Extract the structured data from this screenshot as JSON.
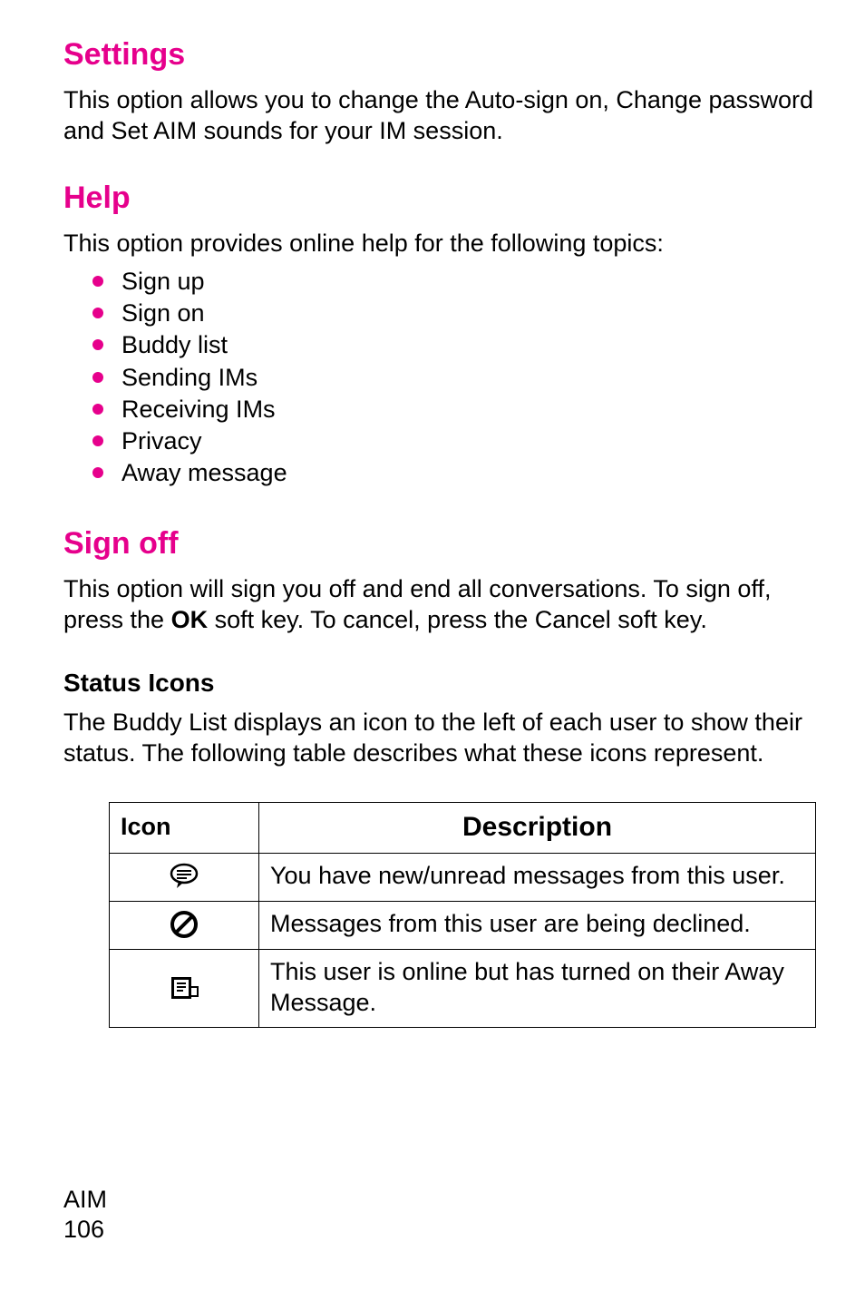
{
  "sections": {
    "settings": {
      "heading": "Settings",
      "body": "This option allows you to change the Auto-sign on, Change password and Set AIM sounds for your IM session."
    },
    "help": {
      "heading": "Help",
      "intro": "This option provides online help for the following topics:",
      "items": [
        "Sign up",
        "Sign on",
        "Buddy list",
        "Sending IMs",
        "Receiving IMs",
        "Privacy",
        "Away message"
      ]
    },
    "signoff": {
      "heading": "Sign off",
      "body_pre": "This option will sign you off and end all conversations. To sign off, press the ",
      "body_bold": "OK",
      "body_post": " soft key. To cancel, press the Cancel soft key."
    },
    "status_icons": {
      "heading": "Status Icons",
      "intro": "The Buddy List displays an icon to the left of each user to show their status. The following table describes what these icons represent.",
      "col_icon": "Icon",
      "col_desc": "Description",
      "rows": [
        {
          "icon_name": "message-bubble-icon",
          "desc": "You have new/unread messages from this user."
        },
        {
          "icon_name": "blocked-icon",
          "desc": "Messages from this user are being declined."
        },
        {
          "icon_name": "away-note-icon",
          "desc": "This user is online but has turned on their Away Message."
        }
      ]
    }
  },
  "footer": {
    "label": "AIM",
    "page": "106"
  }
}
